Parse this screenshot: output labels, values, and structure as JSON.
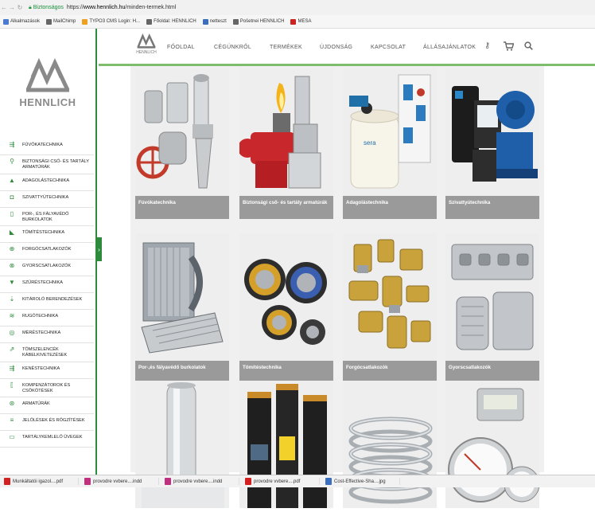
{
  "browser": {
    "secure_label": "Biztonságos",
    "url_prefix": "https://",
    "url_host": "www.hennlich.hu",
    "url_path": "/minden-termek.html",
    "bookmarks": [
      {
        "label": "Alkalmazások",
        "color": "#4a7bd0"
      },
      {
        "label": "MailChimp",
        "color": "#666666"
      },
      {
        "label": "TYPO3 CMS Login: H...",
        "color": "#f0a020"
      },
      {
        "label": "Főoldal: HENNLICH",
        "color": "#666666"
      },
      {
        "label": "netteszt",
        "color": "#3a6fc0"
      },
      {
        "label": "Pošetnei HENNLICH",
        "color": "#666666"
      },
      {
        "label": "MESA",
        "color": "#cc2222"
      }
    ]
  },
  "sidebar": {
    "brand": "HENNLICH",
    "items": [
      {
        "label": "FÚVÓKATECHNIKA",
        "icon": "nozzle-icon",
        "glyph": "⇶"
      },
      {
        "label": "BIZTONSÁGI CSŐ- ÉS TARTÁLY ARMATÚRÁK",
        "icon": "valve-icon",
        "glyph": "⚲"
      },
      {
        "label": "ADAGOLÁSTECHNIKA",
        "icon": "dosing-icon",
        "glyph": "▲"
      },
      {
        "label": "SZIVATTYÚTECHNIKA",
        "icon": "pump-icon",
        "glyph": "◘"
      },
      {
        "label": "POR-, ÉS FÁLYAVÉDŐ BURKOLATOK",
        "icon": "cover-icon",
        "glyph": "▯"
      },
      {
        "label": "TÖMÍTÉSTECHNIKA",
        "icon": "seal-icon",
        "glyph": "◣"
      },
      {
        "label": "FORGÓCSATLAKOZÓK",
        "icon": "rotary-joint-icon",
        "glyph": "⊕"
      },
      {
        "label": "GYORSCSATLAKOZÓK",
        "icon": "quick-coupling-icon",
        "glyph": "⊗"
      },
      {
        "label": "SZŰRÉSTECHNIKA",
        "icon": "filter-icon",
        "glyph": "▼"
      },
      {
        "label": "KITÁROLÓ BERENDEZÉSEK",
        "icon": "storage-icon",
        "glyph": "⇣"
      },
      {
        "label": "RUGÓTECHNIKA",
        "icon": "spring-icon",
        "glyph": "≋"
      },
      {
        "label": "MÉRÉSTECHNIKA",
        "icon": "gauge-icon",
        "glyph": "◎"
      },
      {
        "label": "TÖMSZELENCÉK KÁBELKIVETEZÉSEK",
        "icon": "cable-gland-icon",
        "glyph": "⇗"
      },
      {
        "label": "KENÉSTECHNIKA",
        "icon": "lubrication-icon",
        "glyph": "⇶"
      },
      {
        "label": "KOMPENZÁTOROK ÉS CSŐKÖTÉSEK",
        "icon": "compensator-icon",
        "glyph": "⟦"
      },
      {
        "label": "ARMATÚRÁK",
        "icon": "fitting-icon",
        "glyph": "⊛"
      },
      {
        "label": "JELÖLÉSEK ÉS RÖGZÍTÉSEK",
        "icon": "marking-icon",
        "glyph": "≡"
      },
      {
        "label": "TARTÁLYKEMLELŐ ÜVEGEK",
        "icon": "sight-glass-icon",
        "glyph": "▭"
      }
    ],
    "toggle_glyph": "›"
  },
  "header": {
    "brand": "HENNLICH",
    "nav": [
      {
        "label": "FŐOLDAL",
        "name": "nav-fooldal"
      },
      {
        "label": "CÉGÜNKRŐL",
        "name": "nav-cegunkrol"
      },
      {
        "label": "TERMÉKEK",
        "name": "nav-termekek"
      },
      {
        "label": "ÚJDONSÁG",
        "name": "nav-ujdonsag"
      },
      {
        "label": "KAPCSOLAT",
        "name": "nav-kapcsolat"
      },
      {
        "label": "ÁLLÁSAJÁNLATOK",
        "name": "nav-allasajanlatok"
      }
    ]
  },
  "products": [
    {
      "caption": "Fúvókatechnika"
    },
    {
      "caption": "Biztonsági cső- és tartály armatúrák"
    },
    {
      "caption": "Adagolástechnika"
    },
    {
      "caption": "Szivattyútechnika"
    },
    {
      "caption": "Por-,és fályavédő burkolatok"
    },
    {
      "caption": "Tömítéstechnika"
    },
    {
      "caption": "Forgócsatlakozók"
    },
    {
      "caption": "Gyorscsatlakozók"
    },
    {
      "caption": ""
    },
    {
      "caption": ""
    },
    {
      "caption": ""
    },
    {
      "caption": ""
    }
  ],
  "taskbar": [
    {
      "label": "Munkáltatói igazol....pdf",
      "color": "#d42020"
    },
    {
      "label": "provodre vvbere....indd",
      "color": "#c0307f"
    },
    {
      "label": "provodre vvbere....indd",
      "color": "#c0307f"
    },
    {
      "label": "provodre vvbere....pdf",
      "color": "#d42020"
    },
    {
      "label": "Cost-Effective-Sha....jpg",
      "color": "#3a6fc0"
    }
  ],
  "colors": {
    "brand_green": "#2e8b3c",
    "nav_line": "#7dbd6c",
    "caption_bg": "#9a9a9a"
  }
}
